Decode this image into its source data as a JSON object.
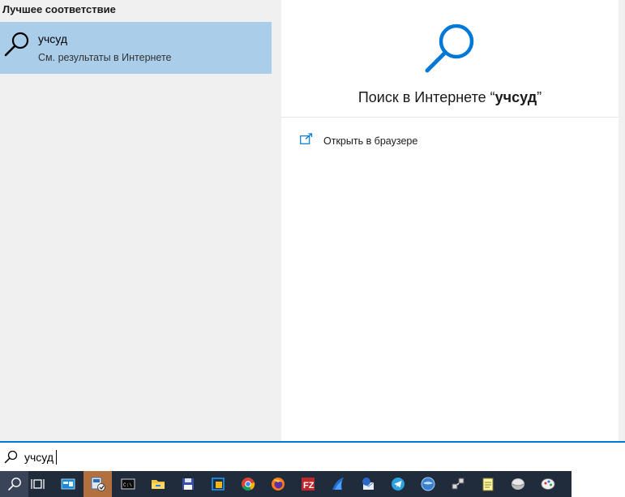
{
  "search_panel": {
    "section_heading": "Лучшее соответствие",
    "best_match": {
      "title": "учсуд",
      "subtitle": "См. результаты в Интернете",
      "icon": "search-icon"
    }
  },
  "preview": {
    "title_prefix": "Поиск в Интернете “",
    "title_query": "учсуд",
    "title_suffix": "”",
    "icon": "search-icon",
    "actions": [
      {
        "label": "Открыть в браузере",
        "icon": "open-external-icon"
      }
    ]
  },
  "search_box": {
    "value": "учсуд",
    "icon": "search-icon"
  },
  "taskbar": {
    "items": [
      {
        "name": "search",
        "icon": "search-icon"
      },
      {
        "name": "task-view",
        "icon": "task-view-icon"
      },
      {
        "name": "app-blue-window",
        "icon": "window-icon"
      },
      {
        "name": "app-active",
        "icon": "control-panel-icon",
        "active": true
      },
      {
        "name": "terminal",
        "icon": "terminal-icon"
      },
      {
        "name": "file-explorer",
        "icon": "folder-icon"
      },
      {
        "name": "floppy-app",
        "icon": "floppy-icon"
      },
      {
        "name": "virtualbox",
        "icon": "box-icon"
      },
      {
        "name": "chrome",
        "icon": "chrome-icon"
      },
      {
        "name": "firefox",
        "icon": "firefox-icon"
      },
      {
        "name": "filezilla",
        "icon": "filezilla-icon"
      },
      {
        "name": "shark-app",
        "icon": "fin-icon"
      },
      {
        "name": "thunderbird",
        "icon": "mail-bird-icon"
      },
      {
        "name": "telegram",
        "icon": "telegram-icon"
      },
      {
        "name": "globe-app",
        "icon": "globe-icon"
      },
      {
        "name": "network-app",
        "icon": "network-icon"
      },
      {
        "name": "notes-app",
        "icon": "notepad-icon"
      },
      {
        "name": "disk-app",
        "icon": "disk-icon"
      },
      {
        "name": "paint-app",
        "icon": "paint-icon"
      }
    ]
  },
  "colors": {
    "accent": "#0078d7",
    "selected_result": "#aacde9",
    "taskbar_bg": "#202b3c",
    "taskbar_active": "#b3703f",
    "panel_bg": "#f0f0f0"
  }
}
